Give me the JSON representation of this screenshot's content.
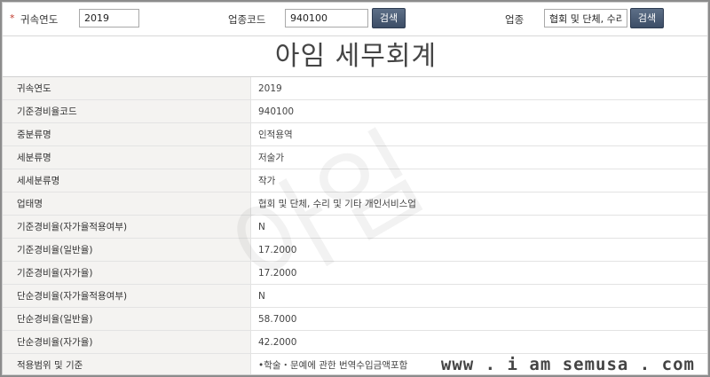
{
  "search": {
    "required_mark": "*",
    "year_label": "귀속연도",
    "year_value": "2019",
    "code_label": "업종코드",
    "code_value": "940100",
    "search_button": "검색",
    "industry_label": "업종",
    "industry_value": "협회 및 단체, 수리",
    "search_button_2": "검색"
  },
  "title": "아임 세무회계",
  "watermark": "아임",
  "rows": [
    {
      "key": "귀속연도",
      "value": "2019"
    },
    {
      "key": "기준경비율코드",
      "value": "940100"
    },
    {
      "key": "중분류명",
      "value": "인적용역"
    },
    {
      "key": "세분류명",
      "value": "저술가"
    },
    {
      "key": "세세분류명",
      "value": "작가"
    },
    {
      "key": "업태명",
      "value": "협회 및 단체, 수리 및 기타 개인서비스업"
    },
    {
      "key": "기준경비율(자가율적용여부)",
      "value": "N"
    },
    {
      "key": "기준경비율(일반율)",
      "value": "17.2000"
    },
    {
      "key": "기준경비율(자가율)",
      "value": "17.2000"
    },
    {
      "key": "단순경비율(자가율적용여부)",
      "value": "N"
    },
    {
      "key": "단순경비율(일반율)",
      "value": "58.7000"
    },
    {
      "key": "단순경비율(자가율)",
      "value": "42.2000"
    },
    {
      "key": "적용범위 및 기준",
      "value": "•학술・문예에 관한 번역수입금액포함"
    }
  ],
  "site_url": "www . i am semusa . com"
}
